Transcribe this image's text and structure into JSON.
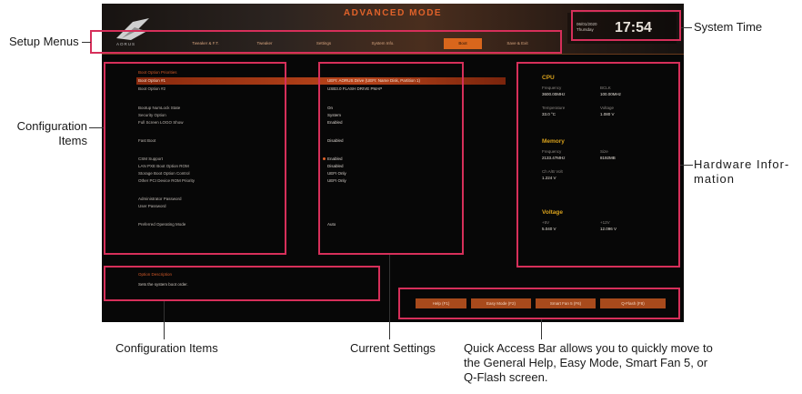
{
  "bios": {
    "mode_title": "ADVANCED MODE",
    "logo_text": "AORUS",
    "tabs": [
      {
        "label": "Tweaker & F.T.",
        "active": false
      },
      {
        "label": "Tweaker",
        "active": false
      },
      {
        "label": "Settings",
        "active": false
      },
      {
        "label": "System Info.",
        "active": false
      },
      {
        "label": "Boot",
        "active": true
      },
      {
        "label": "Save & Exit",
        "active": false
      }
    ],
    "clock": {
      "date": "06/01/2020",
      "weekday": "Thursday",
      "time": "17:54"
    },
    "config_items": [
      {
        "label": "Boot Option Priorities",
        "value": "",
        "header": true
      },
      {
        "label": "Boot Option #1",
        "value": "UEFI: AORUS Drive (UEFI: Name Disk, Partition 1)",
        "selected": true
      },
      {
        "label": "Boot Option #2",
        "value": "USB3.0 FLASH DRIVE PMAP"
      },
      {
        "label": "Bootup NumLock State",
        "value": "On"
      },
      {
        "label": "Security Option",
        "value": "System"
      },
      {
        "label": "Full Screen LOGO Show",
        "value": "Enabled"
      },
      {
        "label": "Fast Boot",
        "value": "Disabled"
      },
      {
        "label": "CSM Support",
        "value": "Enabled"
      },
      {
        "label": "LAN PXE Boot Option ROM",
        "value": "Disabled"
      },
      {
        "label": "Storage Boot Option Control",
        "value": "UEFI Only"
      },
      {
        "label": "Other PCI Device ROM Priority",
        "value": "UEFI Only"
      },
      {
        "label": "Administrator Password",
        "value": ""
      },
      {
        "label": "User Password",
        "value": ""
      },
      {
        "label": "Preferred Operating Mode",
        "value": "Auto"
      }
    ],
    "option_description": {
      "title": "Option Description",
      "text": "Sets the system boot order."
    },
    "hardware": {
      "cpu": {
        "title": "CPU",
        "freq_label": "Frequency",
        "freq": "3600.00MHz",
        "bclk_label": "BCLK",
        "bclk": "100.00MHz",
        "temp_label": "Temperature",
        "temp": "33.0 °C",
        "volt_label": "Voltage",
        "volt": "1.080 V"
      },
      "memory": {
        "title": "Memory",
        "freq_label": "Frequency",
        "freq": "2133.47MHz",
        "size_label": "Size",
        "size": "8192MB",
        "ch_label": "Ch A/B Volt",
        "ch": "1.224 V"
      },
      "voltage": {
        "title": "Voltage",
        "v5_label": "+5V",
        "v5": "5.040 V",
        "v12_label": "+12V",
        "v12": "12.096 V"
      }
    },
    "quick_access": [
      "Help (F1)",
      "Easy Mode (F2)",
      "Smart Fan 5 (F6)",
      "Q-Flash (F8)"
    ]
  },
  "annotations": {
    "setup_menus": "Setup Menus",
    "configuration_items_left_1": "Configuration",
    "configuration_items_left_2": "Items",
    "system_time": "System Time",
    "hardware_info_1": "Hardware Infor-",
    "hardware_info_2": "mation",
    "configuration_items_bottom": "Configuration Items",
    "current_settings": "Current Settings",
    "quick_access_1": "Quick Access Bar allows you to quickly move to",
    "quick_access_2": "the General Help, Easy Mode, Smart Fan 5, or",
    "quick_access_3": "Q-Flash screen."
  },
  "colors": {
    "accent": "#d9661c",
    "annotation_box": "#d62f5a",
    "hw_heading": "#d8a11c"
  }
}
